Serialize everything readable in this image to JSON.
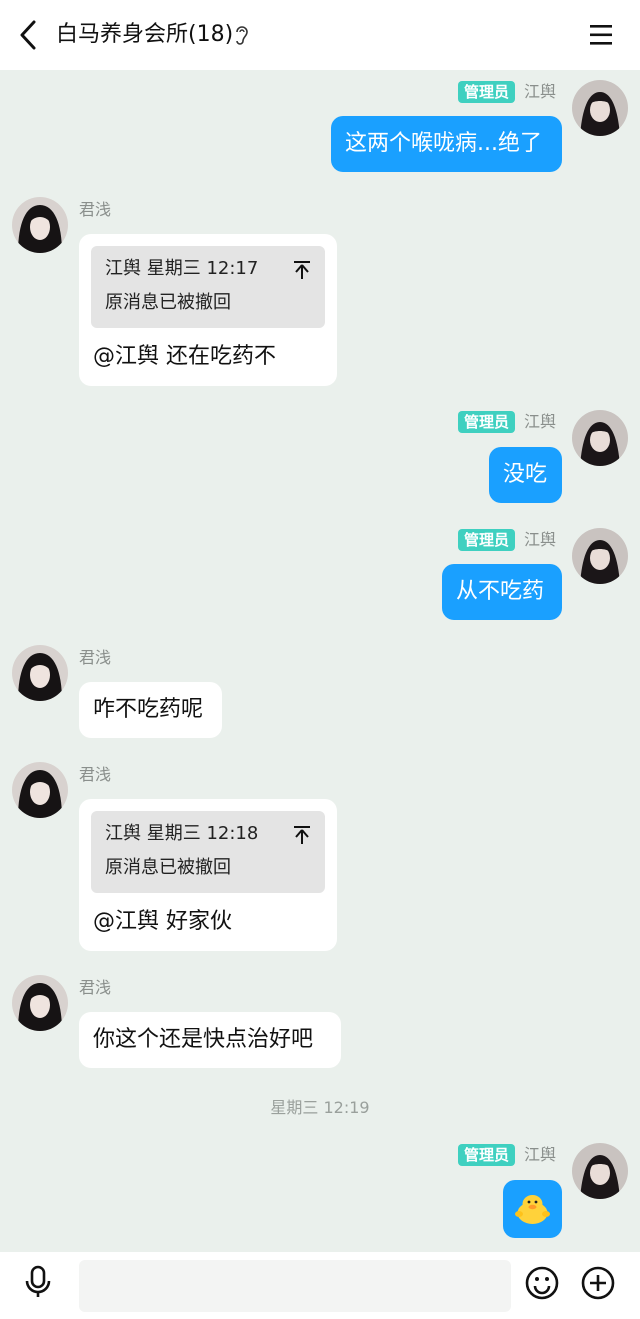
{
  "header": {
    "title": "白马养身会所(18)"
  },
  "admin_badge": "管理员",
  "messages": [
    {
      "sender": "江舆",
      "text": "这两个喉咙病...绝了"
    },
    {
      "sender": "君浅",
      "quote_header": "江舆 星期三 12:17",
      "quote_body": "原消息已被撤回",
      "reply": "@江舆 还在吃药不"
    },
    {
      "sender": "江舆",
      "text": "没吃"
    },
    {
      "sender": "江舆",
      "text": "从不吃药"
    },
    {
      "sender": "君浅",
      "text": "咋不吃药呢"
    },
    {
      "sender": "君浅",
      "quote_header": "江舆 星期三 12:18",
      "quote_body": "原消息已被撤回",
      "reply": "@江舆 好家伙"
    },
    {
      "sender": "君浅",
      "text": "你这个还是快点治好吧"
    },
    {
      "timestamp": "星期三 12:19"
    },
    {
      "sender": "江舆",
      "sticker": "duck-emoji"
    }
  ],
  "colors": {
    "outgoing": "#1aa0ff",
    "badge": "#3fd0c0",
    "background": "#eaf0ec"
  }
}
